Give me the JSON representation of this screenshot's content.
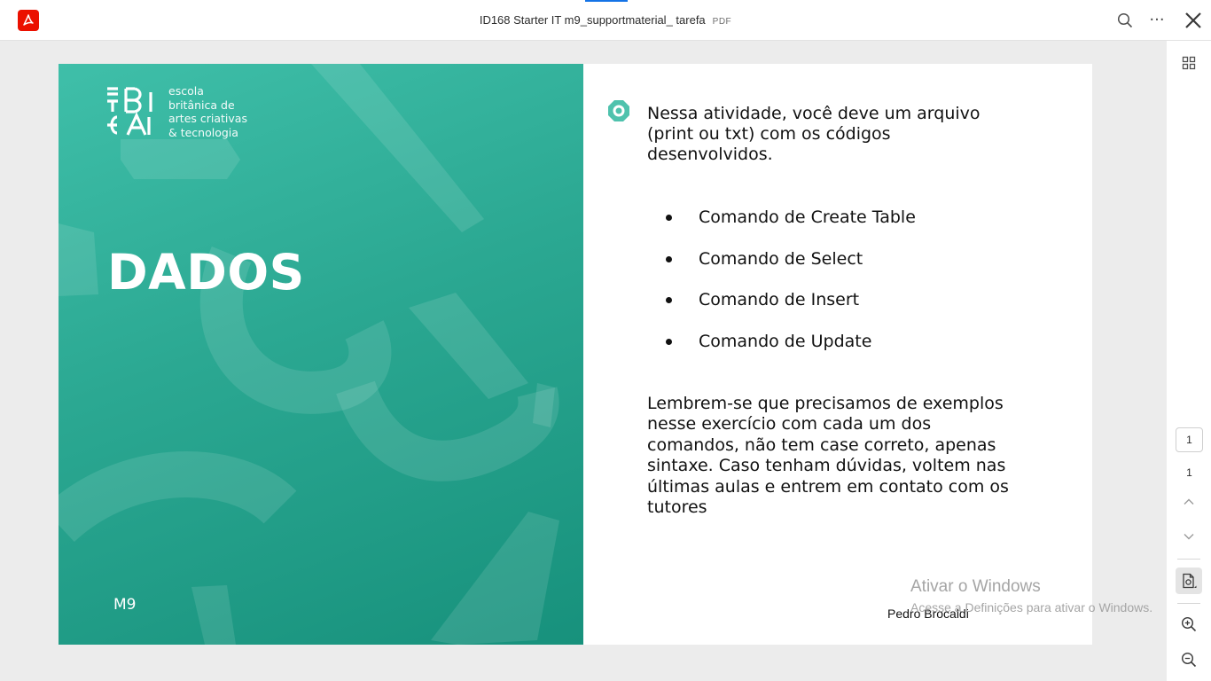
{
  "toolbar": {
    "title": "ID168 Starter IT m9_supportmaterial_ tarefa",
    "file_type": "PDF",
    "more_label": "···"
  },
  "icons": [
    "acrobat-logo-icon",
    "search-icon",
    "more-icon",
    "close-icon",
    "thumbnails-icon",
    "chevron-up-icon",
    "chevron-down-icon",
    "convert-pdf-icon",
    "zoom-in-icon",
    "zoom-out-icon",
    "target-bullet-icon"
  ],
  "colors": {
    "accent": "#1473e6",
    "brand_red": "#eb1000",
    "cover_teal": "#2ba892"
  },
  "pager": {
    "current": "1",
    "total": "1"
  },
  "cover": {
    "brand_lines": [
      "escola",
      "britânica de",
      "artes criativas",
      "& tecnologia"
    ],
    "title": "DADOS",
    "module": "M9"
  },
  "content": {
    "intro": "Nessa atividade, você deve um arquivo (print ou txt) com os códigos desenvolvidos.",
    "bullets": [
      "Comando de Create Table",
      "Comando de Select",
      "Comando de Insert",
      "Comando de Update"
    ],
    "closing": "Lembrem-se que precisamos de exemplos nesse exercício com cada um dos comandos, não tem case correto, apenas sintaxe. Caso tenham dúvidas, voltem nas últimas aulas e entrem em contato com os tutores",
    "author": "Pedro Brocaldi"
  },
  "watermark": {
    "title": "Ativar o Windows",
    "subtitle": "Acesse a Definições para ativar o Windows."
  }
}
